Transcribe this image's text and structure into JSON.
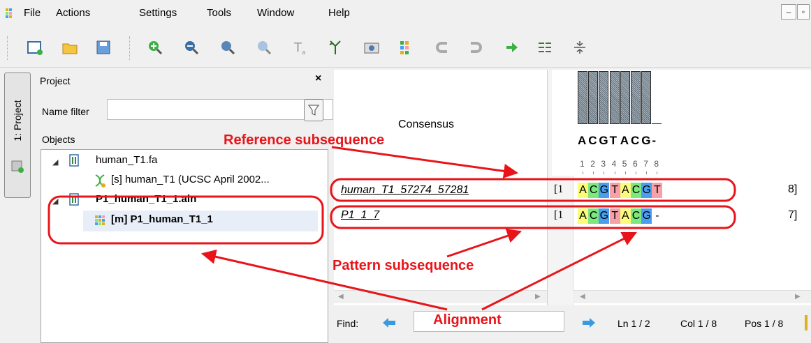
{
  "menubar": {
    "items": [
      "File",
      "Actions",
      "Settings",
      "Tools",
      "Window",
      "Help"
    ]
  },
  "toolbar": {
    "icons": [
      "new-project-icon",
      "open-icon",
      "save-icon",
      "zoom-in-icon",
      "zoom-out-icon",
      "zoom-fit-icon",
      "zoom-to-selection-icon",
      "text-icon",
      "tree-icon",
      "export-image-icon",
      "grid-icon",
      "undo-icon",
      "redo-icon",
      "next-icon",
      "align-icon",
      "collapse-icon"
    ]
  },
  "side_tab": {
    "label": "1: Project"
  },
  "project_panel": {
    "title": "Project",
    "close": "×",
    "name_filter_label": "Name filter",
    "name_filter_value": "",
    "objects_label": "Objects",
    "tree": [
      {
        "label": "human_T1.fa",
        "bold": false
      },
      {
        "label": "[s] human_T1 (UCSC April 2002...",
        "bold": false
      },
      {
        "label": "P1_human_T1_1.aln",
        "bold": true
      },
      {
        "label": "[m] P1_human_T1_1",
        "bold": true
      }
    ]
  },
  "alignment": {
    "consensus_label": "Consensus",
    "consensus_letters": [
      "A",
      "C",
      "G",
      "T",
      "A",
      "C",
      "G",
      "-"
    ],
    "ruler": [
      "1",
      "2",
      "3",
      "4",
      "5",
      "6",
      "7",
      "8"
    ],
    "rows": [
      {
        "name": "human_T1_57274_57281",
        "start": "[1",
        "seq": [
          "A",
          "C",
          "G",
          "T",
          "A",
          "C",
          "G",
          "T"
        ],
        "end": "8]"
      },
      {
        "name": "P1_1_7",
        "start": "[1",
        "seq": [
          "A",
          "C",
          "G",
          "T",
          "A",
          "C",
          "G",
          "-"
        ],
        "end": "7]"
      }
    ]
  },
  "findbar": {
    "find_label": "Find:",
    "find_value": "",
    "ln": "Ln 1 / 2",
    "col": "Col 1 / 8",
    "pos": "Pos 1 / 8"
  },
  "annotations": {
    "reference": "Reference subsequence",
    "pattern": "Pattern subsequence",
    "alignment": "Alignment"
  },
  "colors": {
    "A": "#fcfc7a",
    "C": "#7de87d",
    "G": "#4a9ef0",
    "T": "#f6a0a8",
    "annotation": "#e8141a"
  }
}
